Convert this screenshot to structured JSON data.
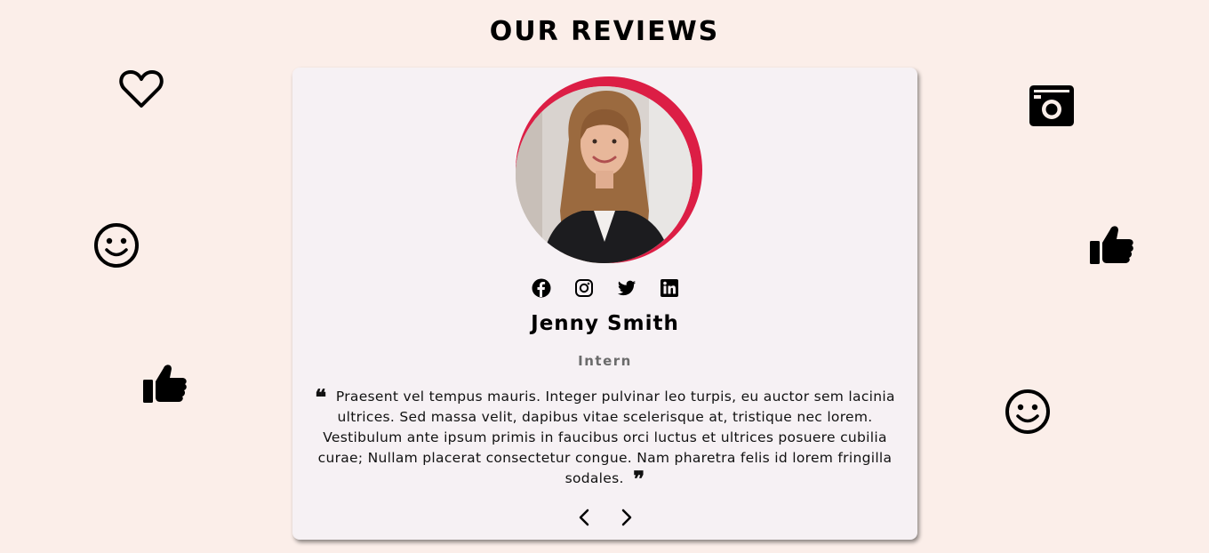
{
  "section": {
    "title": "OUR REVIEWS"
  },
  "review": {
    "name": "Jenny Smith",
    "role": "Intern",
    "quote_open": "❝",
    "quote_close": "❞",
    "text": "Praesent vel tempus mauris. Integer pulvinar leo turpis, eu auctor sem lacinia ultrices. Sed massa velit, dapibus vitae scelerisque at, tristique nec lorem. Vestibulum ante ipsum primis in faucibus orci luctus et ultrices posuere cubilia curae; Nullam placerat consectetur congue. Nam pharetra felis id lorem fringilla sodales."
  },
  "social_icons": [
    "facebook-icon",
    "instagram-icon",
    "twitter-icon",
    "linkedin-icon"
  ],
  "navigation": [
    "chevron-left-icon",
    "chevron-right-icon"
  ],
  "decorative_icons": [
    "heart-icon",
    "smile-icon",
    "thumbs-up-icon",
    "camera-icon",
    "thumbs-up-icon",
    "smile-icon"
  ],
  "colors": {
    "page_background": "#fbeee9",
    "card_background": "#f6f1f4",
    "avatar_ring": "#dc1e45",
    "role_text": "#6b6b6b"
  }
}
